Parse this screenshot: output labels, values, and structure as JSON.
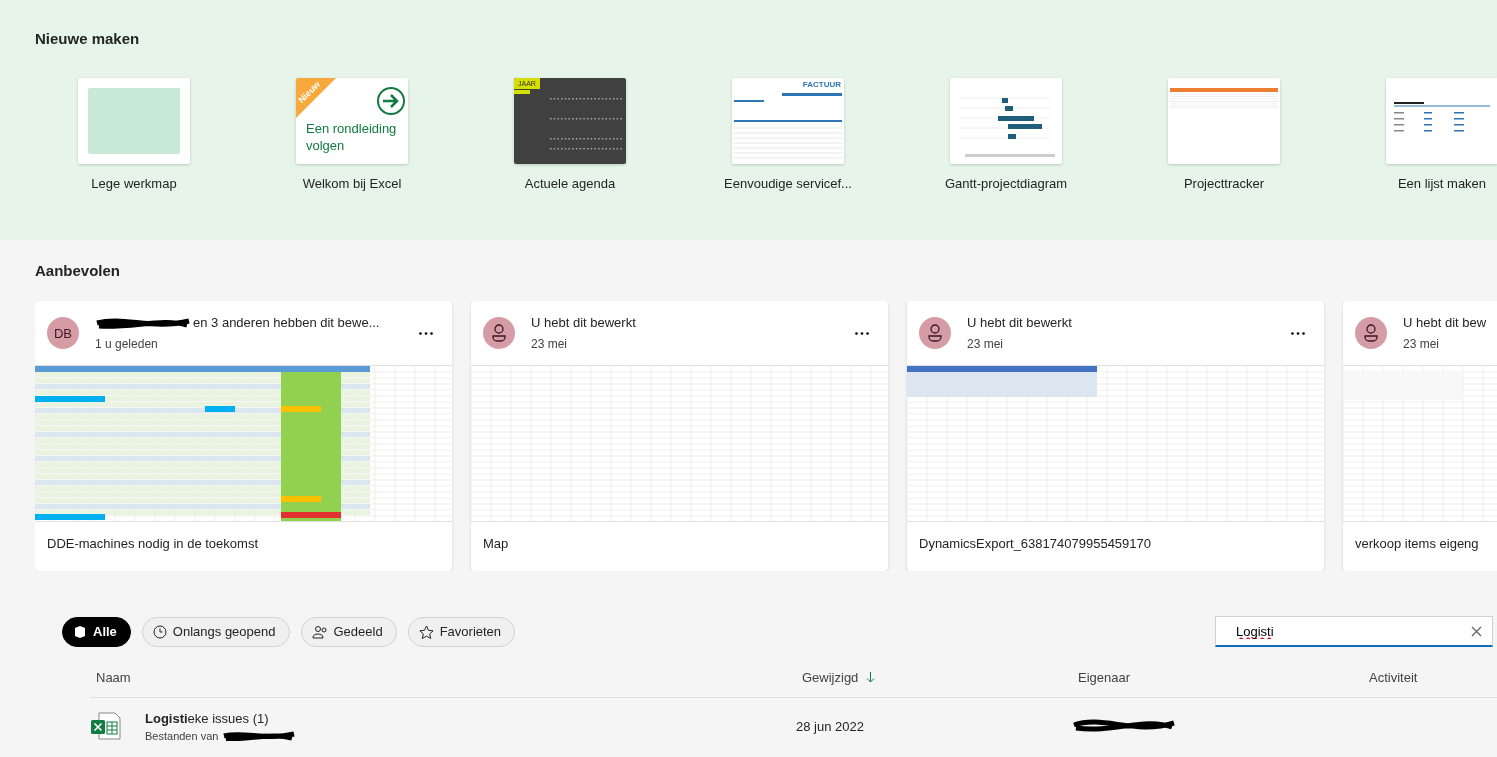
{
  "create": {
    "title": "Nieuwe maken",
    "templates": [
      {
        "kind": "blank",
        "label": "Lege werkmap"
      },
      {
        "kind": "tour",
        "label": "Welkom bij Excel",
        "badge": "Nieuw",
        "thumb_text": "Een rondleiding volgen"
      },
      {
        "kind": "calendar",
        "label": "Actuele agenda",
        "thumb_text": "JAAR"
      },
      {
        "kind": "invoice",
        "label": "Eenvoudige servicef...",
        "thumb_text": "FACTUUR"
      },
      {
        "kind": "gantt",
        "label": "Gantt-projectdiagram"
      },
      {
        "kind": "tracker",
        "label": "Projecttracker"
      },
      {
        "kind": "list",
        "label": "Een lijst maken"
      }
    ]
  },
  "recommended": {
    "title": "Aanbevolen",
    "cards": [
      {
        "kind": "colored",
        "initials": "DB",
        "redacted": true,
        "activity": "en 3 anderen hebben dit bewe...",
        "when": "1 u geleden",
        "name": "DDE-machines nodig in de toekomst"
      },
      {
        "kind": "blank",
        "redacted": false,
        "activity": "U hebt dit bewerkt",
        "when": "23 mei",
        "name": "Map"
      },
      {
        "kind": "table",
        "redacted": false,
        "activity": "U hebt dit bewerkt",
        "when": "23 mei",
        "name": "DynamicsExport_638174079955459170"
      },
      {
        "kind": "list",
        "redacted": false,
        "activity": "U hebt dit bew",
        "when": "23 mei",
        "name": "verkoop items eigeng"
      }
    ]
  },
  "filters": [
    {
      "label": "Alle",
      "selected": true
    },
    {
      "label": "Onlangs geopend",
      "selected": false
    },
    {
      "label": "Gedeeld",
      "selected": false
    },
    {
      "label": "Favorieten",
      "selected": false
    }
  ],
  "search": {
    "value": "Logisti"
  },
  "table": {
    "columns": [
      {
        "label": "Naam",
        "sorted": false
      },
      {
        "label": "Gewijzigd",
        "sorted": true
      },
      {
        "label": "Eigenaar",
        "sorted": false
      },
      {
        "label": "Activiteit",
        "sorted": false
      }
    ],
    "rows": [
      {
        "name": "**Logisti**eke issues (1)",
        "location": "Bestanden van",
        "modified": "28 jun 2022",
        "owner_redacted": true
      }
    ]
  }
}
